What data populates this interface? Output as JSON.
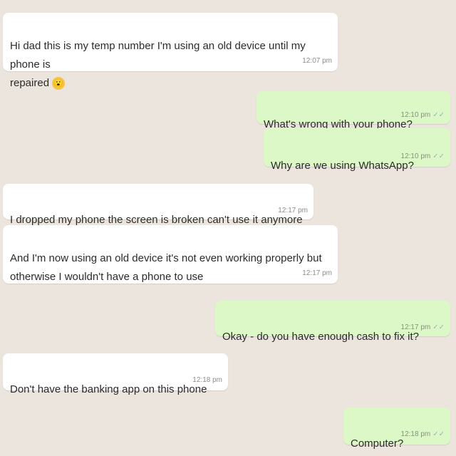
{
  "messages": [
    {
      "direction": "incoming",
      "text": "Hi dad this is my temp number I'm using an old device until my phone is\nrepaired",
      "emoji": "😮",
      "time": "12:07 pm"
    },
    {
      "direction": "outgoing",
      "text": "What's wrong with your phone?",
      "time": "12:10 pm",
      "ticks": "✓✓"
    },
    {
      "direction": "outgoing",
      "text": "Why are we using WhatsApp?",
      "time": "12:10 pm",
      "ticks": "✓✓"
    },
    {
      "direction": "incoming",
      "text": "I dropped my phone the screen is broken can't use it anymore",
      "time": "12:17 pm"
    },
    {
      "direction": "incoming",
      "text": "And I'm now using an old device it's not even working properly but\notherwise I wouldn't have a phone to use",
      "time": "12:17 pm"
    },
    {
      "direction": "outgoing",
      "text": "Okay - do you have enough cash to fix it?",
      "time": "12:17 pm",
      "ticks": "✓✓"
    },
    {
      "direction": "incoming",
      "text": "Don't have the banking app on this phone",
      "time": "12:18 pm"
    },
    {
      "direction": "outgoing",
      "text": "Computer?",
      "time": "12:18 pm",
      "ticks": "✓✓"
    }
  ]
}
